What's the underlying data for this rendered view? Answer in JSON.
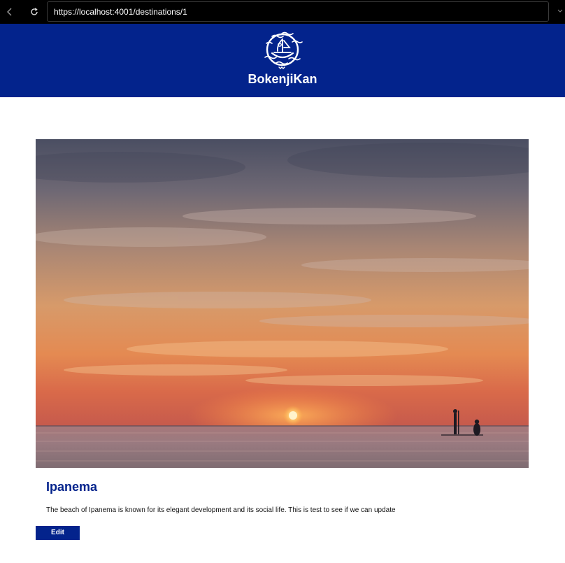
{
  "browser": {
    "url": "https://localhost:4001/destinations/1",
    "back_icon": "chevron-left-icon",
    "reload_icon": "reload-icon"
  },
  "header": {
    "brand": "BokenjiKan",
    "logo_icon": "bokenjikan-logo",
    "background_color": "#03238c"
  },
  "destination": {
    "hero_image": "sunset-beach-photo",
    "title": "Ipanema",
    "description": "The beach of Ipanema is known for its elegant development and its social life. This is test to see if we can update",
    "edit_label": "Edit"
  },
  "colors": {
    "accent": "#03238c",
    "chrome": "#000000"
  }
}
